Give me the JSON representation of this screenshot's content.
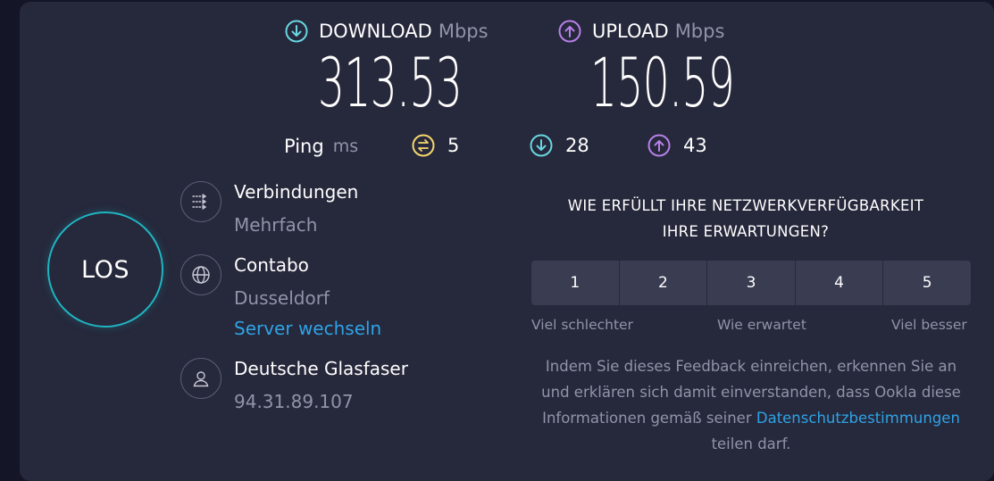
{
  "download": {
    "label": "DOWNLOAD",
    "unit": "Mbps",
    "value": "313.53",
    "icon": "arrow-down-circle-icon",
    "color": "#68d6e0"
  },
  "upload": {
    "label": "UPLOAD",
    "unit": "Mbps",
    "value": "150.59",
    "icon": "arrow-up-circle-icon",
    "color": "#b780e8"
  },
  "ping": {
    "label": "Ping",
    "unit": "ms",
    "idle": {
      "value": "5",
      "icon": "ping-idle-icon",
      "color": "#f5d76e"
    },
    "down": {
      "value": "28",
      "icon": "arrow-down-circle-icon",
      "color": "#68d6e0"
    },
    "up": {
      "value": "43",
      "icon": "arrow-up-circle-icon",
      "color": "#b780e8"
    }
  },
  "go_button": {
    "label": "LOS"
  },
  "connections": {
    "title": "Verbindungen",
    "value": "Mehrfach",
    "icon": "connections-icon"
  },
  "server": {
    "title": "Contabo",
    "location": "Dusseldorf",
    "change_link": "Server wechseln",
    "icon": "globe-icon"
  },
  "provider": {
    "title": "Deutsche Glasfaser",
    "ip": "94.31.89.107",
    "icon": "user-icon"
  },
  "survey": {
    "question_line1": "WIE ERFÜLLT IHRE NETZWERKVERFÜGBARKEIT",
    "question_line2": "IHRE ERWARTUNGEN?",
    "options": [
      "1",
      "2",
      "3",
      "4",
      "5"
    ],
    "scale_low": "Viel schlechter",
    "scale_mid": "Wie erwartet",
    "scale_high": "Viel besser",
    "disclaimer_part1": "Indem Sie dieses Feedback einreichen, erkennen Sie an und erklären sich damit einverstanden, dass Ookla diese Informationen gemäß seiner",
    "privacy_link": "Datenschutzbestimmungen",
    "disclaimer_part2": "teilen darf."
  }
}
